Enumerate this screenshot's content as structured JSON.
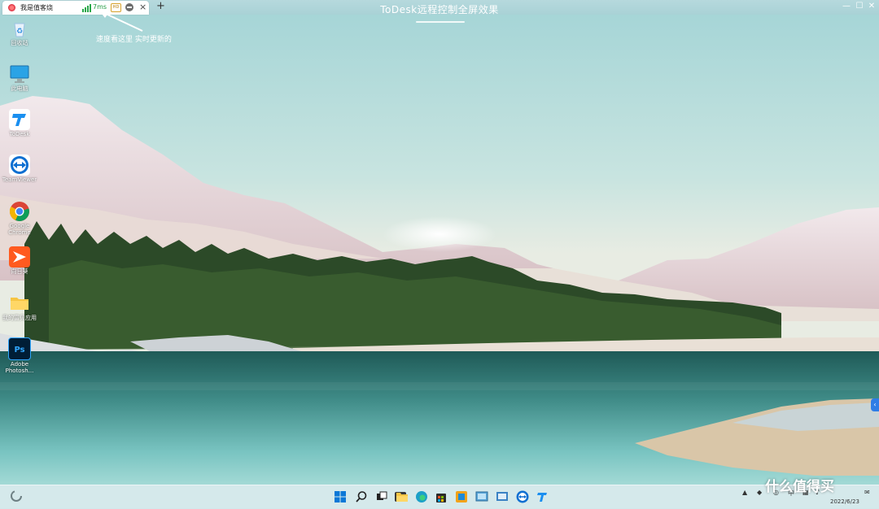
{
  "tab": {
    "title": "我是值客烧",
    "latency": "7ms",
    "quality_badge": "HD"
  },
  "window": {
    "title": "ToDesk远程控制全屏效果",
    "minimize": "—",
    "maximize": "☐",
    "close": "✕",
    "new_tab": "+",
    "tab_close": "×"
  },
  "annotation": {
    "text": "速度看这里 实时更新的"
  },
  "desktop_icons": [
    {
      "label": "回收站",
      "icon": "recycle-bin-icon"
    },
    {
      "label": "此电脑",
      "icon": "this-pc-icon"
    },
    {
      "label": "ToDesk",
      "icon": "todesk-icon"
    },
    {
      "label": "TeamViewer",
      "icon": "teamviewer-icon"
    },
    {
      "label": "Google Chrome",
      "icon": "chrome-icon"
    },
    {
      "label": "向日葵",
      "icon": "sunlogin-icon"
    },
    {
      "label": "我的富贝应用",
      "icon": "folder-icon"
    },
    {
      "label": "Adobe Photosh...",
      "icon": "photoshop-icon"
    }
  ],
  "taskbar": {
    "apps": [
      "start-icon",
      "search-icon",
      "task-view-icon",
      "widgets-icon",
      "file-explorer-icon",
      "edge-icon",
      "store-icon",
      "app-icon",
      "remote-app-icon",
      "teamviewer-icon",
      "teamviewer-icon",
      "todesk-icon"
    ],
    "clock_time": "",
    "clock_date": "2022/6/23"
  },
  "watermark": "什么值得买",
  "colors": {
    "accent": "#2e7de6",
    "sky_top": "#9fd3d6",
    "water": "#2f7d7b"
  }
}
